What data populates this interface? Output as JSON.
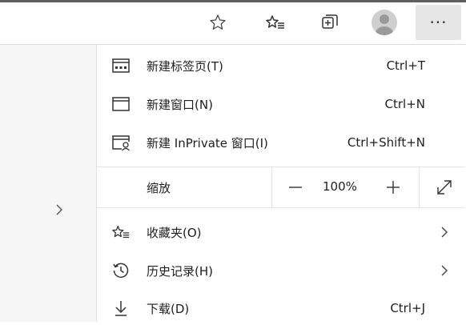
{
  "toolbar": {
    "icons": [
      "star-outline-icon",
      "favorites-list-icon",
      "collections-icon",
      "profile-avatar-icon",
      "more-dots-icon"
    ],
    "more_label": "···"
  },
  "menu": {
    "items": [
      {
        "label": "新建标签页(T)",
        "shortcut": "Ctrl+T",
        "icon": "new-tab-icon"
      },
      {
        "label": "新建窗口(N)",
        "shortcut": "Ctrl+N",
        "icon": "new-window-icon"
      },
      {
        "label": "新建 InPrivate 窗口(I)",
        "shortcut": "Ctrl+Shift+N",
        "icon": "inprivate-window-icon"
      }
    ],
    "zoom": {
      "label": "缩放",
      "value": "100%",
      "minus": "—",
      "plus": "+"
    },
    "items2": [
      {
        "label": "收藏夹(O)",
        "icon": "favorites-icon",
        "has_submenu": true
      },
      {
        "label": "历史记录(H)",
        "icon": "history-icon",
        "has_submenu": true
      },
      {
        "label": "下载(D)",
        "shortcut": "Ctrl+J",
        "icon": "download-icon"
      }
    ]
  },
  "colors": {
    "accent_gray": "#e6e6e6",
    "text": "#1f1f1f",
    "separator": "#e4e4e4"
  }
}
